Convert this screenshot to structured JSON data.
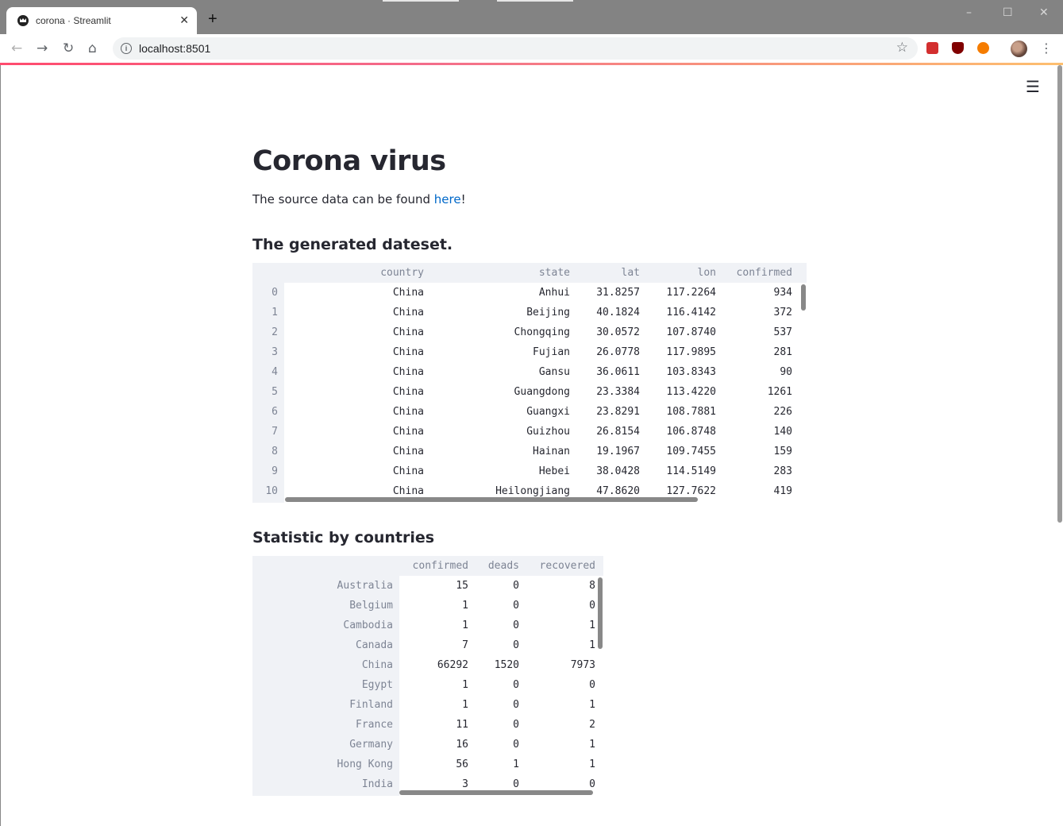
{
  "browser": {
    "tab_title": "corona · Streamlit",
    "new_tab_glyph": "+",
    "url": "localhost:8501",
    "icons": [
      "back-icon",
      "forward-icon",
      "reload-icon",
      "home-icon",
      "info-icon",
      "star-icon",
      "menu-kebab-icon"
    ]
  },
  "page": {
    "title": "Corona virus",
    "intro_text": "The source data can be found ",
    "intro_link": "here",
    "intro_suffix": "!",
    "section1_heading": "The generated dateset.",
    "section2_heading": "Statistic by countries",
    "accent_color": "#ff4b4b",
    "link_color": "#0068c9"
  },
  "dataset_table": {
    "columns": [
      "country",
      "state",
      "lat",
      "lon",
      "confirmed"
    ],
    "rows": [
      {
        "index": "0",
        "cells": [
          "China",
          "Anhui",
          "31.8257",
          "117.2264",
          "934"
        ]
      },
      {
        "index": "1",
        "cells": [
          "China",
          "Beijing",
          "40.1824",
          "116.4142",
          "372"
        ]
      },
      {
        "index": "2",
        "cells": [
          "China",
          "Chongqing",
          "30.0572",
          "107.8740",
          "537"
        ]
      },
      {
        "index": "3",
        "cells": [
          "China",
          "Fujian",
          "26.0778",
          "117.9895",
          "281"
        ]
      },
      {
        "index": "4",
        "cells": [
          "China",
          "Gansu",
          "36.0611",
          "103.8343",
          "90"
        ]
      },
      {
        "index": "5",
        "cells": [
          "China",
          "Guangdong",
          "23.3384",
          "113.4220",
          "1261"
        ]
      },
      {
        "index": "6",
        "cells": [
          "China",
          "Guangxi",
          "23.8291",
          "108.7881",
          "226"
        ]
      },
      {
        "index": "7",
        "cells": [
          "China",
          "Guizhou",
          "26.8154",
          "106.8748",
          "140"
        ]
      },
      {
        "index": "8",
        "cells": [
          "China",
          "Hainan",
          "19.1967",
          "109.7455",
          "159"
        ]
      },
      {
        "index": "9",
        "cells": [
          "China",
          "Hebei",
          "38.0428",
          "114.5149",
          "283"
        ]
      },
      {
        "index": "10",
        "cells": [
          "China",
          "Heilongjiang",
          "47.8620",
          "127.7622",
          "419"
        ]
      }
    ]
  },
  "country_table": {
    "columns": [
      "confirmed",
      "deads",
      "recovered"
    ],
    "rows": [
      {
        "index": "Australia",
        "cells": [
          "15",
          "0",
          "8"
        ]
      },
      {
        "index": "Belgium",
        "cells": [
          "1",
          "0",
          "0"
        ]
      },
      {
        "index": "Cambodia",
        "cells": [
          "1",
          "0",
          "1"
        ]
      },
      {
        "index": "Canada",
        "cells": [
          "7",
          "0",
          "1"
        ]
      },
      {
        "index": "China",
        "cells": [
          "66292",
          "1520",
          "7973"
        ]
      },
      {
        "index": "Egypt",
        "cells": [
          "1",
          "0",
          "0"
        ]
      },
      {
        "index": "Finland",
        "cells": [
          "1",
          "0",
          "1"
        ]
      },
      {
        "index": "France",
        "cells": [
          "11",
          "0",
          "2"
        ]
      },
      {
        "index": "Germany",
        "cells": [
          "16",
          "0",
          "1"
        ]
      },
      {
        "index": "Hong Kong",
        "cells": [
          "56",
          "1",
          "1"
        ]
      },
      {
        "index": "India",
        "cells": [
          "3",
          "0",
          "0"
        ]
      }
    ]
  }
}
